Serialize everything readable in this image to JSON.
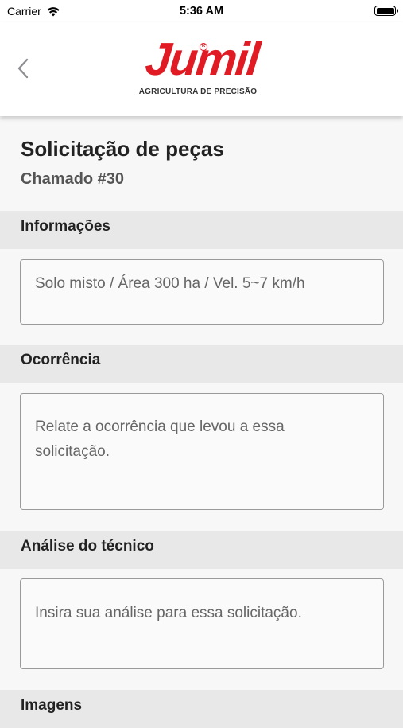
{
  "status_bar": {
    "carrier": "Carrier",
    "time": "5:36 AM"
  },
  "header": {
    "back_icon": "chevron-left-icon",
    "logo": {
      "brand": "Jumil",
      "tagline": "AGRICULTURA DE PRECISÃO",
      "brand_color": "#e01b23"
    }
  },
  "page": {
    "title": "Solicitação de peças",
    "subtitle": "Chamado #30"
  },
  "sections": {
    "informacoes": {
      "label": "Informações",
      "field_value": "Solo misto / Área 300 ha / Vel. 5~7 km/h"
    },
    "ocorrencia": {
      "label": "Ocorrência",
      "placeholder": "Relate a ocorrência que levou a essa solicitação."
    },
    "analise": {
      "label": "Análise do técnico",
      "placeholder": "Insira sua análise para essa solicitação."
    },
    "imagens": {
      "label": "Imagens"
    }
  }
}
